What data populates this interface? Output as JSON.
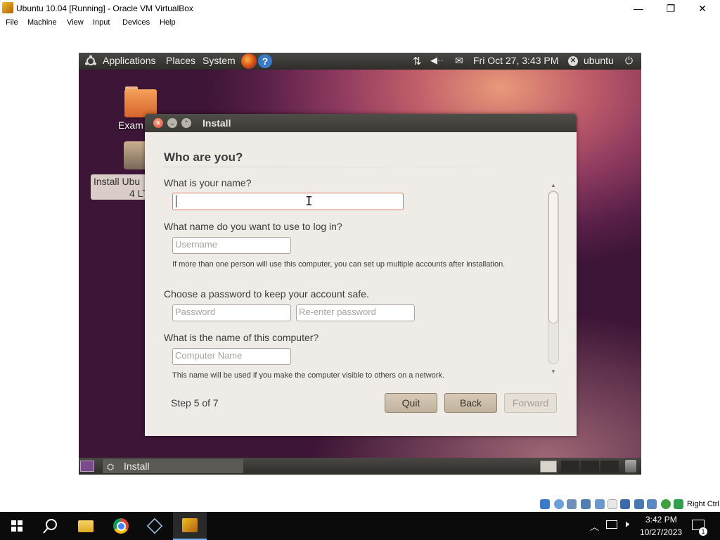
{
  "window": {
    "title": "Ubuntu 10.04 [Running] - Oracle VM VirtualBox",
    "minimize": "—",
    "maximize": "❐",
    "close": "✕"
  },
  "menubar": {
    "items": [
      "File",
      "Machine",
      "View",
      "Input",
      "Devices",
      "Help"
    ]
  },
  "gnome_top_panel": {
    "applications": "Applications",
    "places": "Places",
    "system": "System",
    "datetime": "Fri Oct 27,  3:43 PM",
    "user": "ubuntu"
  },
  "desktop": {
    "folder_label": "Exam",
    "install_label_line1": "Install Ubu",
    "install_label_line2": "4 LT"
  },
  "dialog": {
    "title": "Install",
    "heading": "Who are you?",
    "name_question": "What is your name?",
    "name_value": "",
    "login_question": "What name do you want to use to log in?",
    "username_placeholder": "Username",
    "multi_account_hint": "If more than one person will use this computer, you can set up multiple accounts after installation.",
    "password_question": "Choose a password to keep your account safe.",
    "password_placeholder": "Password",
    "reenter_placeholder": "Re-enter password",
    "computer_question": "What is the name of this computer?",
    "computer_placeholder": "Computer Name",
    "computer_hint": "This name will be used if you make the computer visible to others on a network.",
    "step": "Step 5 of 7",
    "quit": "Quit",
    "back": "Back",
    "forward": "Forward"
  },
  "gnome_bottom_panel": {
    "task": "Install"
  },
  "vbox_status": {
    "host_key": "Right Ctrl"
  },
  "taskbar": {
    "time": "3:42 PM",
    "date": "10/27/2023",
    "notifications": "1"
  },
  "colors": {
    "accent_field_border": "#e07a6a",
    "panel": "#3a3935",
    "dialog_bg": "#efebe7"
  }
}
